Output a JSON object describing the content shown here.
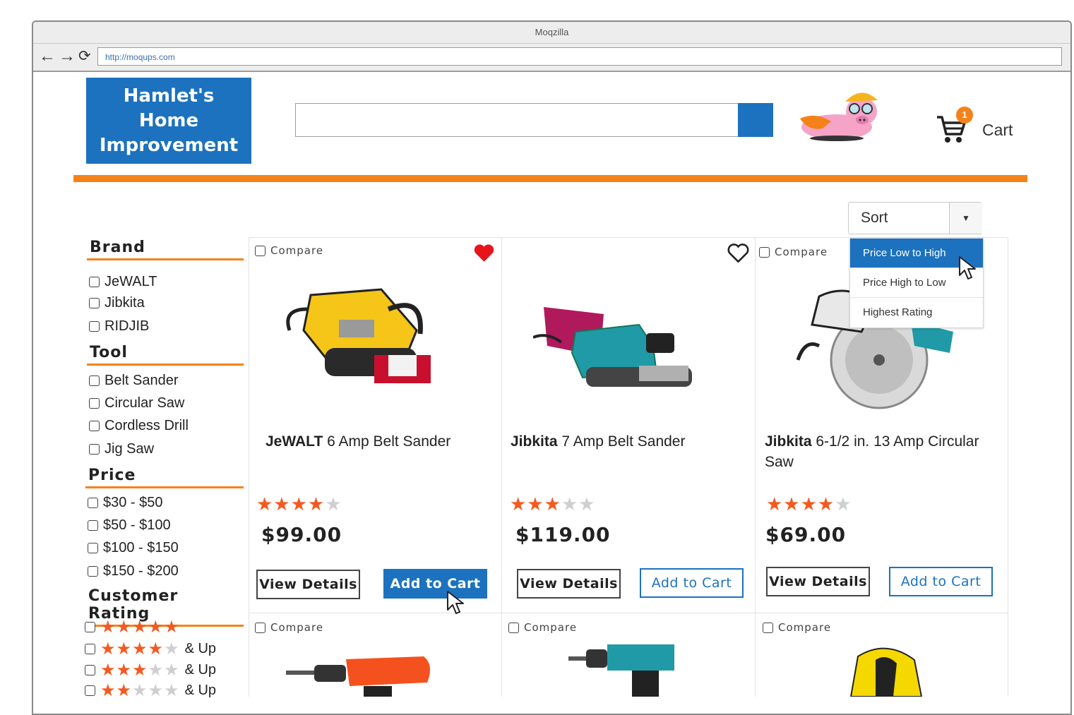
{
  "browser": {
    "title": "Moqzilla",
    "url": "http://moqups.com",
    "back_icon": "←",
    "forward_icon": "→",
    "reload_icon": "⟳"
  },
  "header": {
    "logo_lines": [
      "Hamlet's",
      "Home",
      "Improvement"
    ],
    "search_value": "",
    "cart_label": "Cart",
    "cart_count": "1"
  },
  "sort": {
    "label": "Sort",
    "options": [
      "Price Low to High",
      "Price High to Low",
      "Highest Rating"
    ],
    "highlighted": "Price Low to High"
  },
  "filters": {
    "brand": {
      "title": "Brand",
      "options": [
        "JeWALT",
        "Jibkita",
        "RIDJIB"
      ]
    },
    "tool": {
      "title": "Tool",
      "options": [
        "Belt Sander",
        "Circular Saw",
        "Cordless Drill",
        "Jig Saw"
      ]
    },
    "price": {
      "title": "Price",
      "options": [
        "$30 - $50",
        "$50 - $100",
        "$100 - $150",
        "$150 - $200"
      ]
    },
    "rating": {
      "title": "Customer Rating",
      "and_up": "& Up",
      "levels": [
        5,
        4,
        3,
        2
      ]
    }
  },
  "products": [
    {
      "brand": "JeWALT",
      "name": "6 Amp Belt Sander",
      "rating": 4,
      "price": "$99.00",
      "favorited": true
    },
    {
      "brand": "Jibkita",
      "name": "7 Amp Belt Sander",
      "rating": 3,
      "price": "$119.00",
      "favorited": false
    },
    {
      "brand": "Jibkita",
      "name": "6-1/2 in. 13 Amp Circular Saw",
      "rating": 4,
      "price": "$69.00",
      "favorited": false
    }
  ],
  "labels": {
    "compare": "Compare",
    "view_details": "View Details",
    "add_to_cart": "Add to Cart"
  },
  "colors": {
    "brand_blue": "#1c72be",
    "accent_orange": "#f58219",
    "star_orange": "#f5591f",
    "heart_red": "#e8141c"
  }
}
